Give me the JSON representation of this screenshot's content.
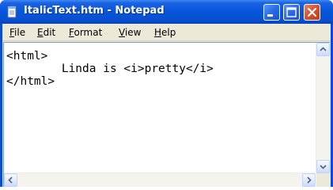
{
  "window": {
    "title": "ItalicText.htm - Notepad"
  },
  "menu": {
    "file": {
      "accel": "F",
      "rest": "ile"
    },
    "edit": {
      "accel": "E",
      "rest": "dit"
    },
    "format": {
      "accel": "F",
      "rest": "ormat"
    },
    "view": {
      "accel": "V",
      "rest": "iew"
    },
    "help": {
      "accel": "H",
      "rest": "elp"
    }
  },
  "editor": {
    "content": "<html>\n        Linda is <i>pretty</i>\n</html>"
  },
  "colors": {
    "titlebar": "#0a58de",
    "frame": "#ece9d8",
    "close_button": "#d8502e"
  }
}
